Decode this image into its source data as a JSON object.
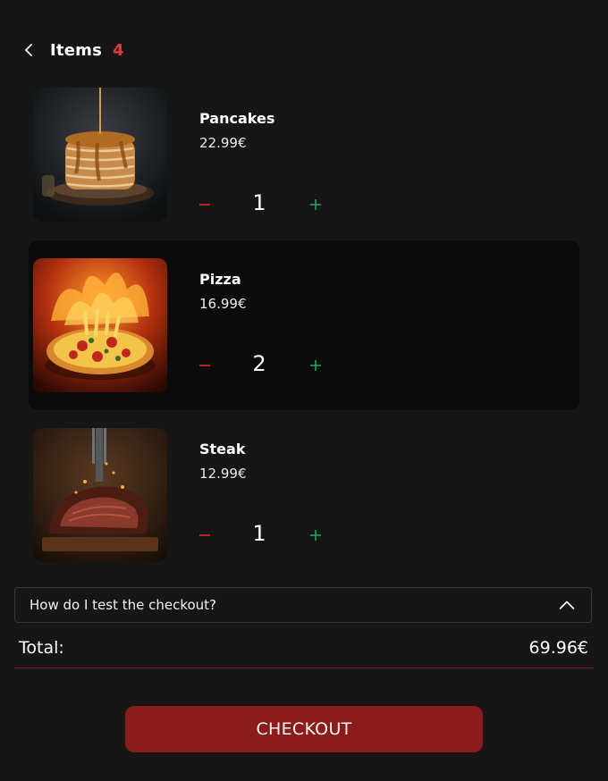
{
  "header": {
    "title": "Items",
    "count": "4"
  },
  "items": [
    {
      "name": "Pancakes",
      "price": "22.99€",
      "quantity": "1",
      "image": "pancakes-stack-photo"
    },
    {
      "name": "Pizza",
      "price": "16.99€",
      "quantity": "2",
      "image": "flaming-pizza-photo"
    },
    {
      "name": "Steak",
      "price": "12.99€",
      "quantity": "1",
      "image": "grilled-steak-photo"
    }
  ],
  "faq": {
    "question": "How do I test the checkout?"
  },
  "total": {
    "label": "Total:",
    "value": "69.96€"
  },
  "checkout": {
    "label": "CHECKOUT"
  },
  "colors": {
    "background": "#161616",
    "selected_item_bg": "#0b0b0b",
    "accent_red": "#e53935",
    "checkout_button": "#8a1c1c",
    "minus": "#c62828",
    "plus": "#2e9e5e"
  },
  "icons": [
    "chevron-left-icon",
    "minus-icon",
    "plus-icon",
    "chevron-up-icon"
  ]
}
